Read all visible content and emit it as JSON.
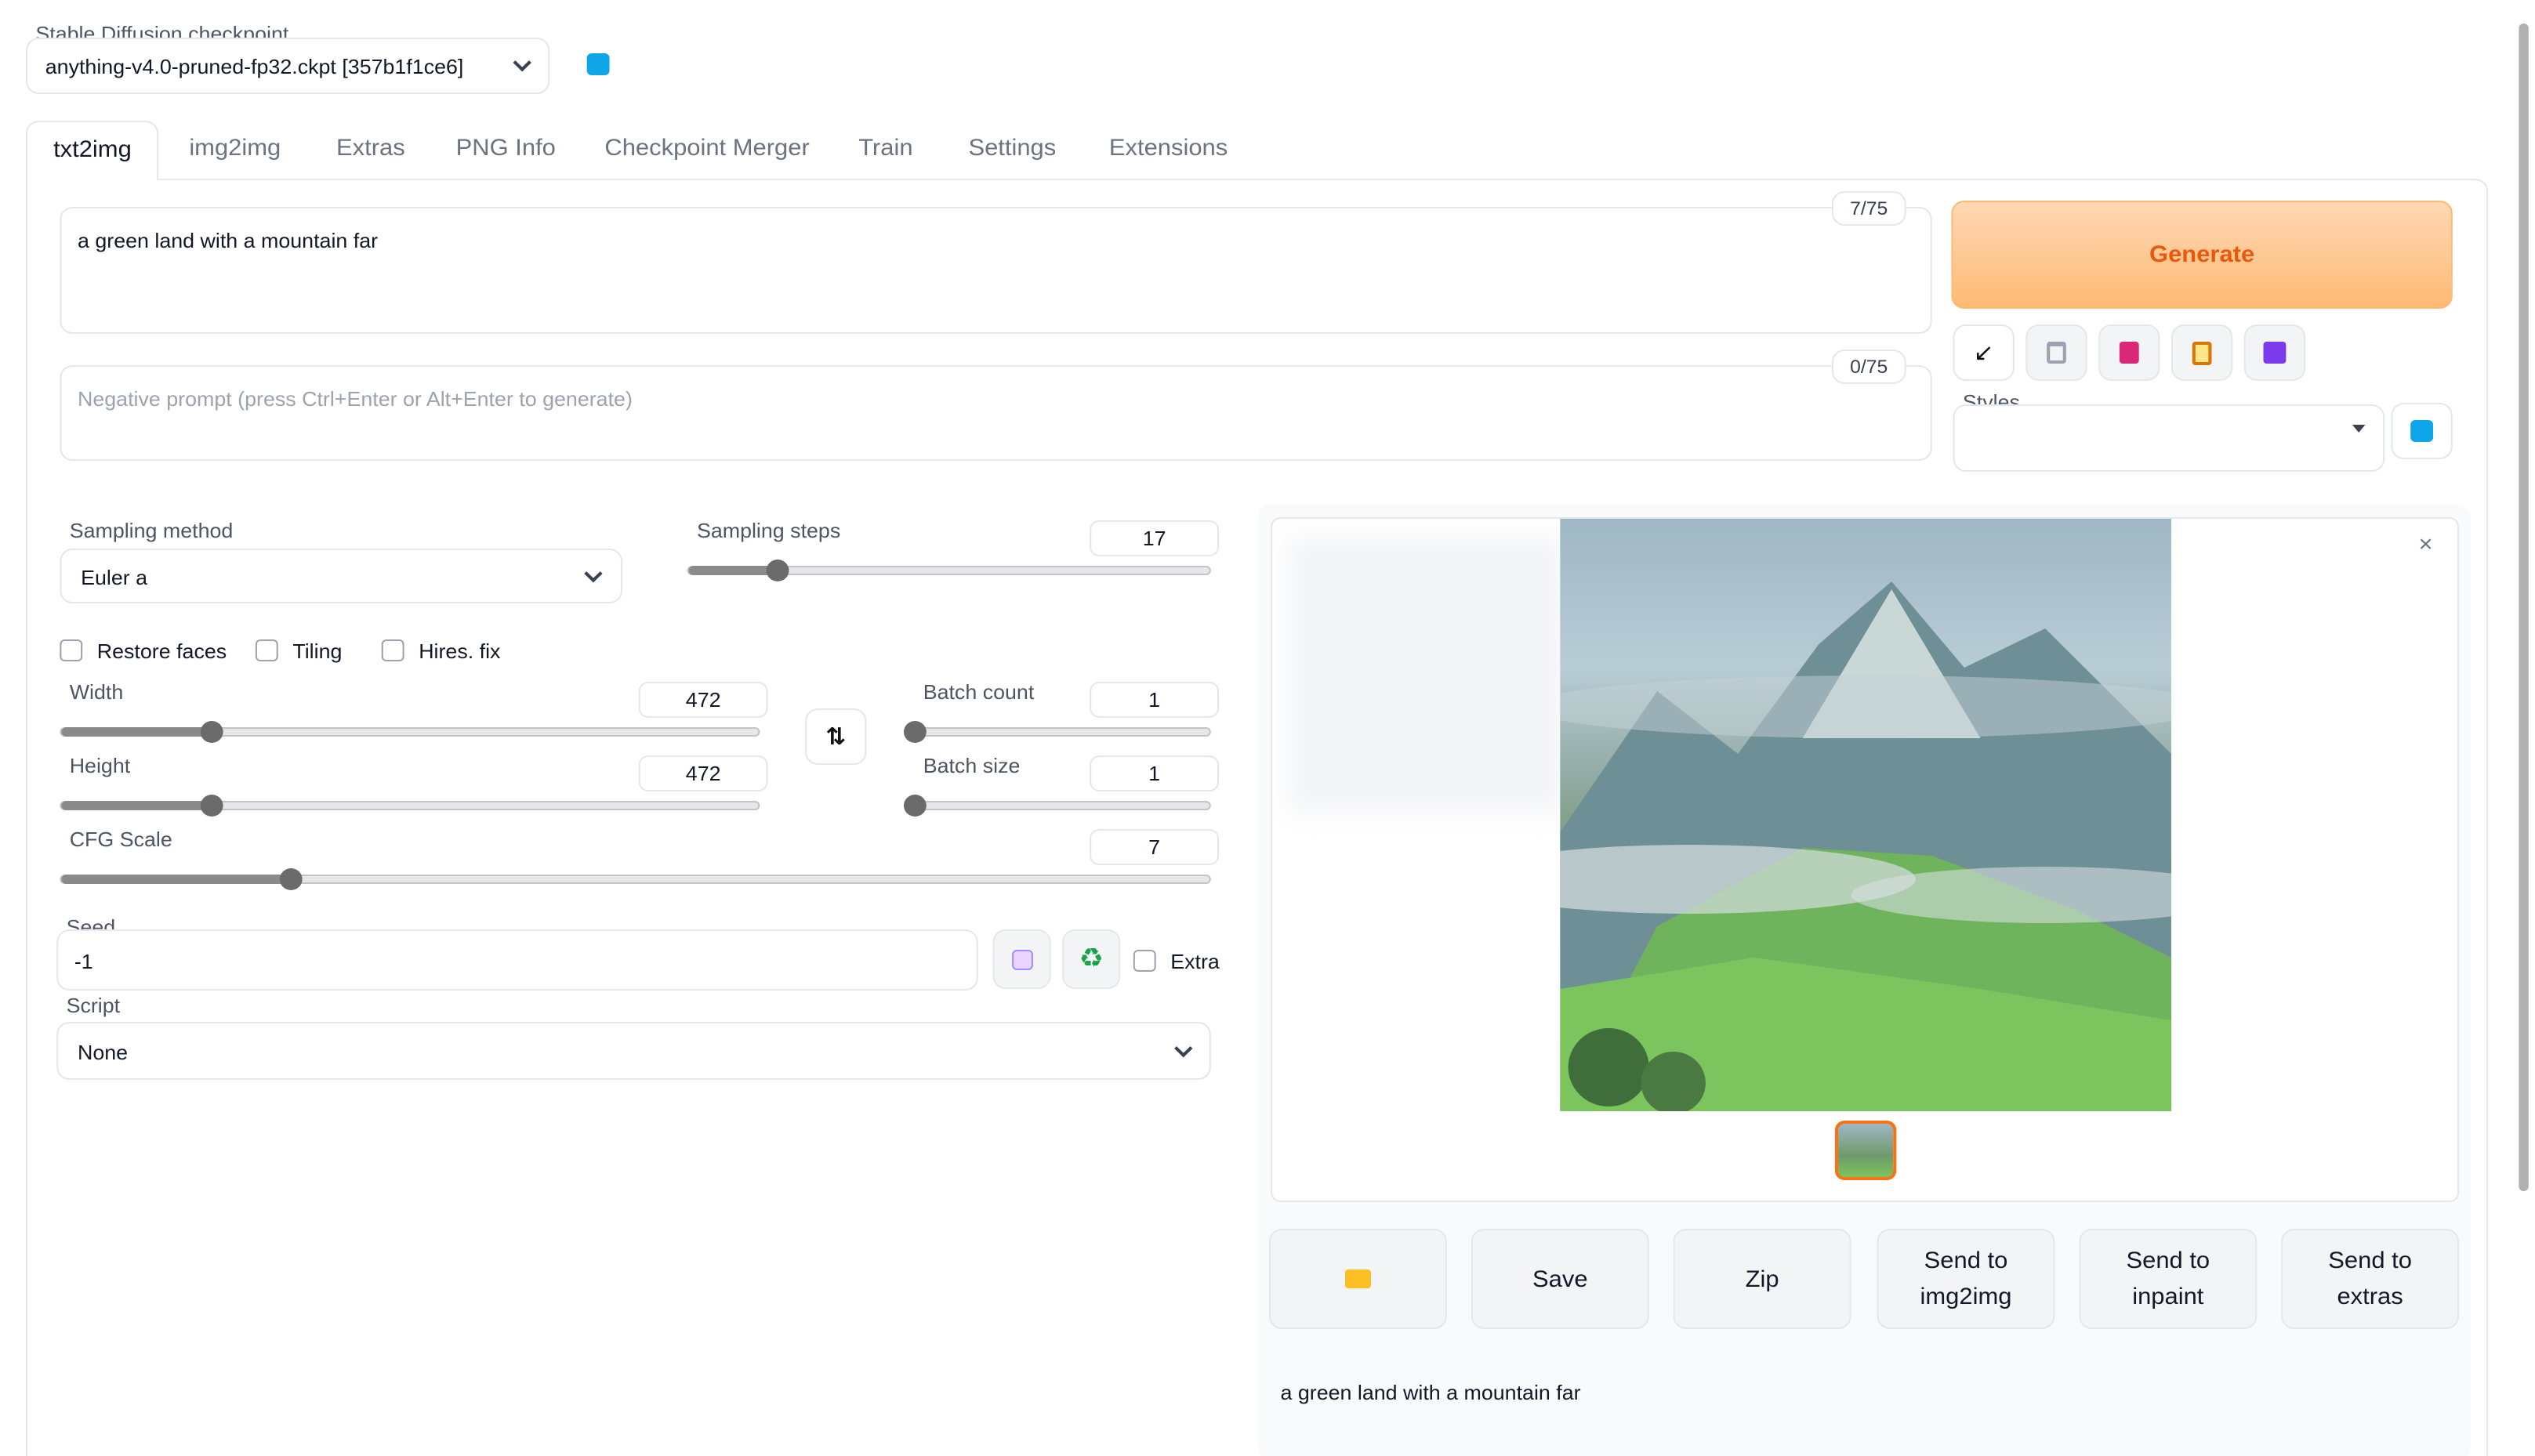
{
  "checkpoint": {
    "label": "Stable Diffusion checkpoint",
    "value": "anything-v4.0-pruned-fp32.ckpt [357b1f1ce6]"
  },
  "tabs": [
    "txt2img",
    "img2img",
    "Extras",
    "PNG Info",
    "Checkpoint Merger",
    "Train",
    "Settings",
    "Extensions"
  ],
  "prompt": {
    "value": "a green land with a mountain far",
    "token_count": "7/75"
  },
  "negative_prompt": {
    "placeholder": "Negative prompt (press Ctrl+Enter or Alt+Enter to generate)",
    "token_count": "0/75"
  },
  "generate_label": "Generate",
  "styles": {
    "label": "Styles"
  },
  "sampling": {
    "method_label": "Sampling method",
    "method_value": "Euler a",
    "steps_label": "Sampling steps",
    "steps_value": "17"
  },
  "checkboxes": {
    "restore_faces": "Restore faces",
    "tiling": "Tiling",
    "hires": "Hires. fix",
    "extra": "Extra"
  },
  "width": {
    "label": "Width",
    "value": "472"
  },
  "height": {
    "label": "Height",
    "value": "472"
  },
  "batch_count": {
    "label": "Batch count",
    "value": "1"
  },
  "batch_size": {
    "label": "Batch size",
    "value": "1"
  },
  "cfg": {
    "label": "CFG Scale",
    "value": "7"
  },
  "seed": {
    "label": "Seed",
    "value": "-1"
  },
  "script": {
    "label": "Script",
    "value": "None"
  },
  "output_buttons": {
    "save": "Save",
    "zip": "Zip",
    "send_img2img": "Send to\nimg2img",
    "send_inpaint": "Send to\ninpaint",
    "send_extras": "Send to\nextras"
  },
  "output_caption": "a green land with a mountain far",
  "colors": {
    "generate_bg": "#fdba74",
    "generate_text": "#ea580c",
    "accent": "#f97316",
    "refresh": "#0ea5e9"
  },
  "slider_levels": {
    "sampling_steps": 0.17,
    "width": 0.215,
    "height": 0.215,
    "batch_count": 0.0,
    "batch_size": 0.0,
    "cfg": 0.2
  },
  "icons": [
    "refresh-icon",
    "arrow-icon",
    "trash-icon",
    "bookmark-icon",
    "clipboard-icon",
    "save-disk-icon",
    "swap-icon",
    "dice-icon",
    "recycle-icon",
    "folder-icon",
    "close-icon"
  ]
}
